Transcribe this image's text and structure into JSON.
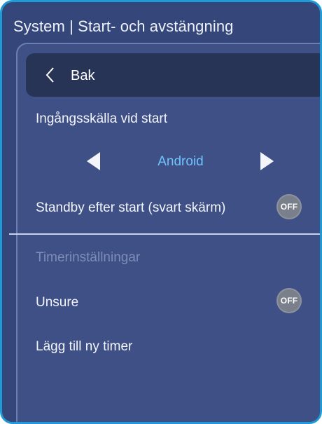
{
  "header": {
    "title": "System | Start- och avstängning"
  },
  "back": {
    "label": "Bak",
    "icon": "chevron-left-icon"
  },
  "input_source": {
    "label": "Ingångsskälla vid start",
    "value": "Android",
    "left_icon": "triangle-left-icon",
    "right_icon": "triangle-right-icon"
  },
  "standby": {
    "label": "Standby efter start (svart skärm)",
    "toggle_text": "OFF"
  },
  "timer_section": {
    "heading": "Timerinställningar"
  },
  "unsure": {
    "label": "Unsure",
    "toggle_text": "OFF"
  },
  "add_timer": {
    "label": "Lägg till ny timer"
  },
  "colors": {
    "accent_border": "#1f9ad6",
    "background": "#35477a",
    "value_text": "#6fc3ff"
  }
}
